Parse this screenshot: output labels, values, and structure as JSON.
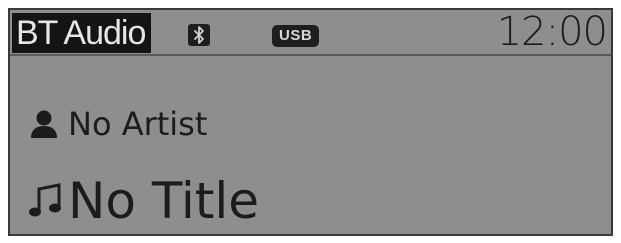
{
  "header": {
    "source_label": "BT Audio",
    "usb_label": "USB",
    "clock": "12:00",
    "bluetooth_icon": "bluetooth-icon"
  },
  "track": {
    "artist": "No Artist",
    "title": "No Title",
    "artist_icon": "person-icon",
    "title_icon": "music-note-icon"
  }
}
